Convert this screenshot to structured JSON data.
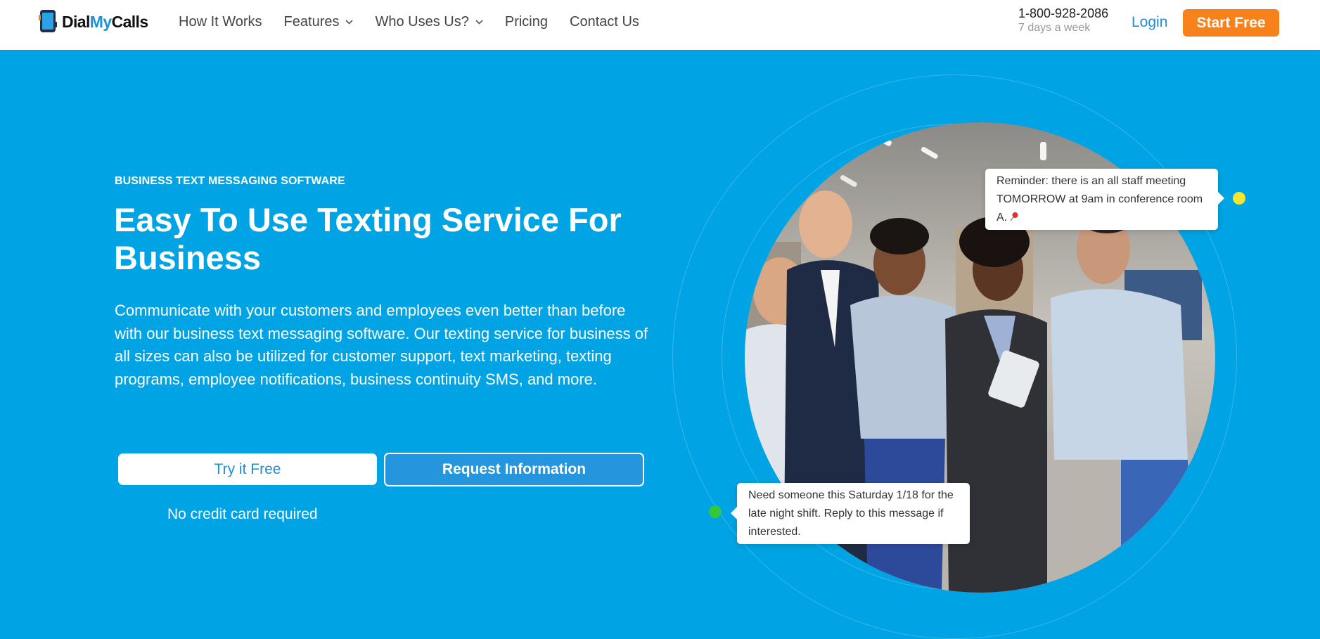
{
  "header": {
    "logo": {
      "part1": "Dial",
      "part2": "My",
      "part3": "Calls"
    },
    "nav": [
      {
        "label": "How It Works",
        "has_dropdown": false
      },
      {
        "label": "Features",
        "has_dropdown": true
      },
      {
        "label": "Who Uses Us?",
        "has_dropdown": true
      },
      {
        "label": "Pricing",
        "has_dropdown": false
      },
      {
        "label": "Contact Us",
        "has_dropdown": false
      }
    ],
    "phone": "1-800-928-2086",
    "hours": "7 days a week",
    "login_label": "Login",
    "start_label": "Start Free"
  },
  "hero": {
    "eyebrow": "BUSINESS TEXT MESSAGING SOFTWARE",
    "headline": "Easy To Use Texting Service For Business",
    "description": "Communicate with your customers and employees even better than before with our business text messaging software. Our texting service for business of all sizes can also be utilized for customer support, text marketing, texting programs, employee notifications, business continuity SMS, and more.",
    "try_label": "Try it Free",
    "request_label": "Request Information",
    "no_credit_card": "No credit card required"
  },
  "messages": {
    "reminder": "Reminder: there is an all staff meeting TOMORROW at 9am in conference room A.",
    "shift": "Need someone this Saturday 1/18 for the late night shift. Reply to this message if interested."
  },
  "icons": {
    "pin": "pushpin-icon",
    "chevron": "chevron-down-icon"
  },
  "colors": {
    "hero_background": "#00a3e3",
    "brand_blue": "#1c93d8",
    "cta_orange": "#f7821b",
    "yellow_dot": "#f5e630",
    "green_dot": "#34c63d"
  }
}
